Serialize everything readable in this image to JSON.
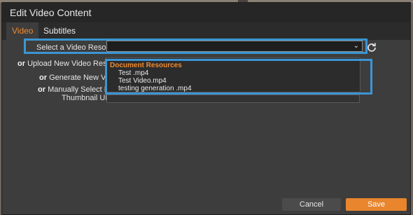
{
  "dialog": {
    "title": "Edit Video Content"
  },
  "tabs": [
    {
      "label": "Video",
      "active": true
    },
    {
      "label": "Subtitles",
      "active": false
    }
  ],
  "form": {
    "select_resource": {
      "label": "Select a Video Resource",
      "value": ""
    },
    "upload": {
      "prefix": "or",
      "label": "Upload New Video Resource"
    },
    "generate": {
      "prefix": "or",
      "label": "Generate New Video"
    },
    "manual": {
      "prefix": "or",
      "label": "Manually Select Files"
    },
    "thumbnail": {
      "label": "Thumbnail URL",
      "value": ""
    }
  },
  "dropdown": {
    "group_label": "Document Resources",
    "items": [
      "Test .mp4",
      "Test Video.mp4",
      "testing generation .mp4"
    ]
  },
  "footer": {
    "cancel_label": "Cancel",
    "save_label": "Save"
  },
  "colors": {
    "accent": "#e8852d",
    "highlight": "#3c95d3"
  },
  "icons": {
    "refresh": "refresh-icon",
    "chevron": "chevron-down-icon"
  }
}
